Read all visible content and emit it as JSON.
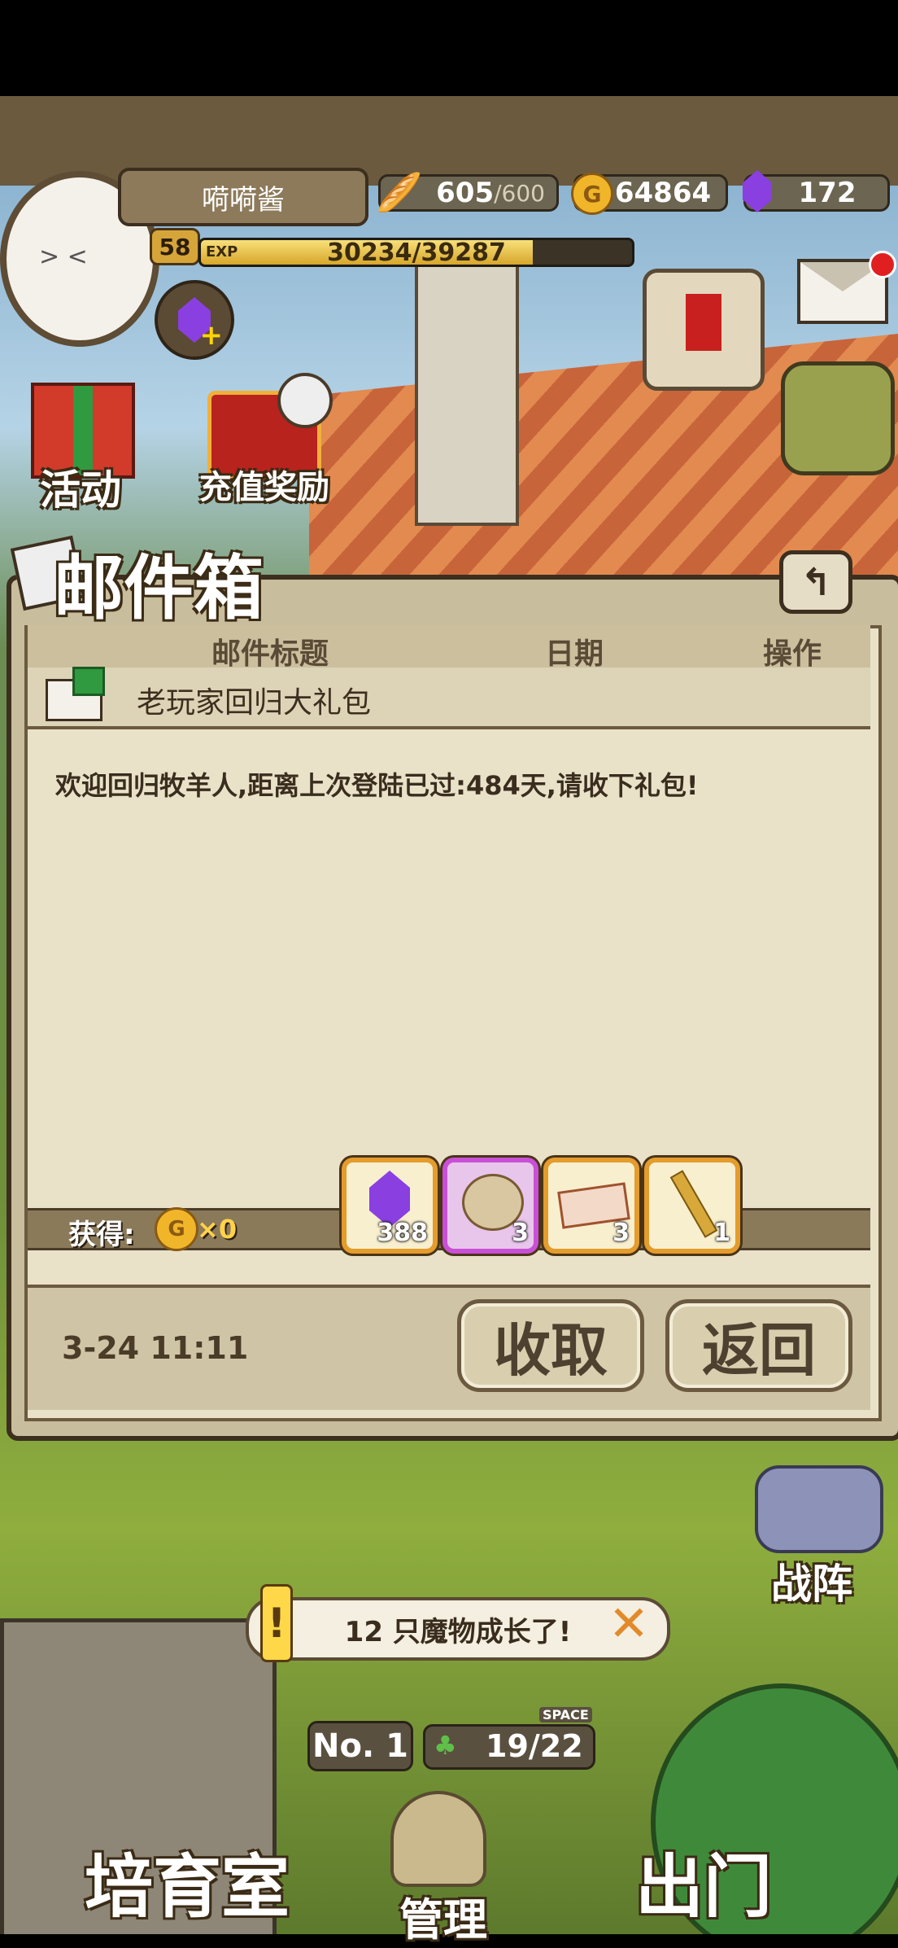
{
  "player": {
    "name": "嗬嗬酱",
    "level": "58",
    "exp_label": "EXP",
    "exp_text": "30234/39287",
    "exp_fraction": 0.77
  },
  "resources": {
    "bread_current": "605",
    "bread_max": "/600",
    "gold": "64864",
    "gem": "172"
  },
  "left_buttons": {
    "activity": "活动",
    "recharge": "充值奖励"
  },
  "mailbox": {
    "title": "邮件箱",
    "columns": [
      "邮件标题",
      "日期",
      "操作"
    ],
    "mail_title": "老玩家回归大礼包",
    "body": "欢迎回归牧羊人,距离上次登陆已过:484天,请收下礼包!",
    "obtain_label": "获得:",
    "gold_count": "×0",
    "items": [
      {
        "icon": "purple-gem-icon",
        "count": "388"
      },
      {
        "icon": "sack-icon",
        "count": "3"
      },
      {
        "icon": "ticket-icon",
        "count": "3"
      },
      {
        "icon": "key-icon",
        "count": "1"
      }
    ],
    "date": "3-24 11:11",
    "collect_button": "收取",
    "back_button": "返回"
  },
  "bottom": {
    "notice": "12 只魔物成长了!",
    "formation": "战阵",
    "rank": "No. 1",
    "space_label": "SPACE",
    "space_value": "19/22",
    "nursery": "培育室",
    "manage": "管理",
    "go_out": "出门"
  },
  "colors": {
    "accent_gold": "#e49c2c",
    "paper": "#e9e2c9",
    "frame": "#6b5a40",
    "gem_purple": "#8a3fe0"
  }
}
